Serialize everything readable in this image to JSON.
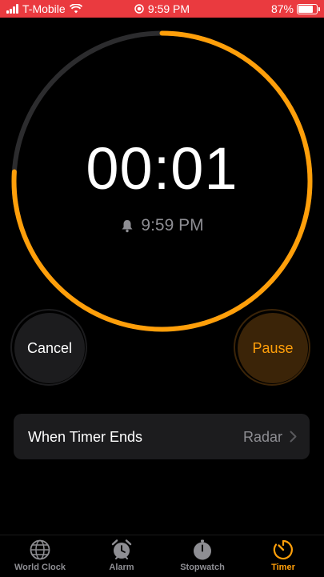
{
  "status_bar": {
    "carrier": "T-Mobile",
    "time": "9:59 PM",
    "battery": "87%",
    "battery_level": 0.87,
    "color": "#ea3a3f"
  },
  "timer": {
    "remaining": "00:01",
    "end_time": "9:59 PM",
    "progress_remaining_fraction": 0.76,
    "accent": "#ff9f0a"
  },
  "controls": {
    "cancel_label": "Cancel",
    "pause_label": "Pause"
  },
  "settings_row": {
    "label": "When Timer Ends",
    "value": "Radar"
  },
  "tabs": [
    {
      "label": "World Clock",
      "icon": "globe-icon"
    },
    {
      "label": "Alarm",
      "icon": "alarm-clock-icon"
    },
    {
      "label": "Stopwatch",
      "icon": "stopwatch-icon"
    },
    {
      "label": "Timer",
      "icon": "timer-icon",
      "active": true
    }
  ]
}
